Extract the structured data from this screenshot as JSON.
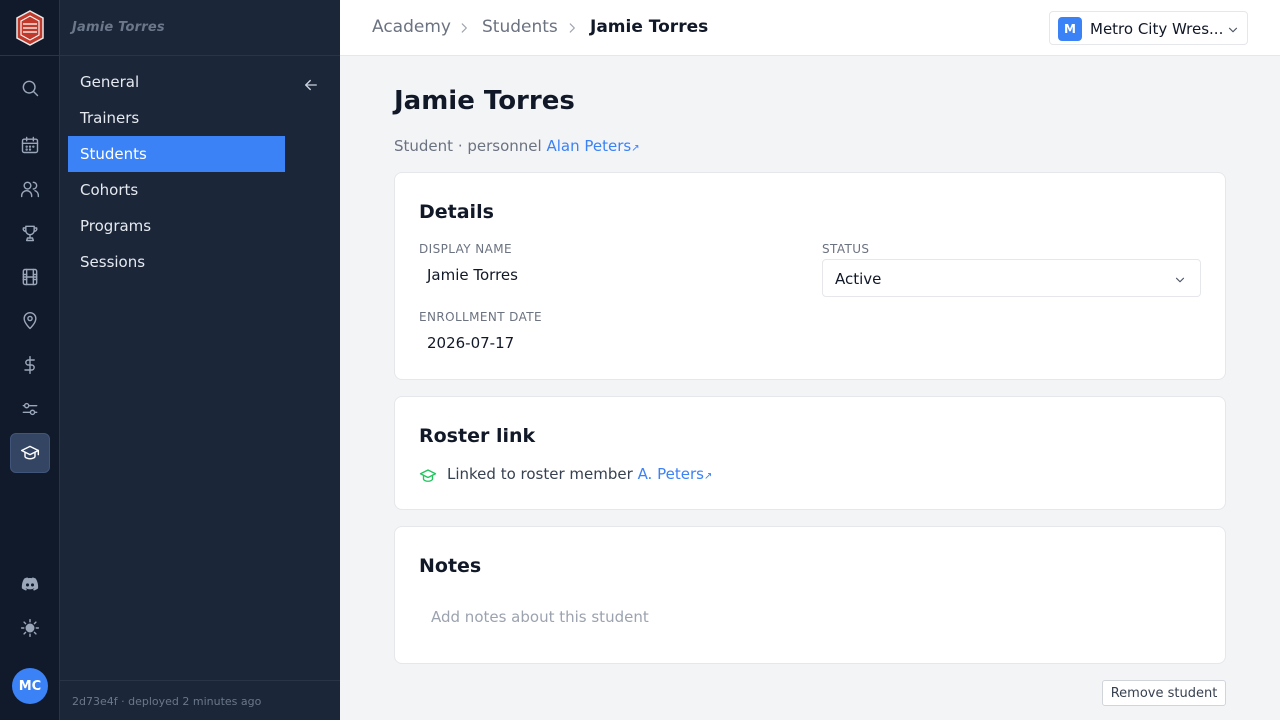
{
  "rail": {
    "items": [
      {
        "name": "search-icon",
        "active": false
      },
      {
        "name": "calendar-icon",
        "active": false
      },
      {
        "name": "users-icon",
        "active": false
      },
      {
        "name": "trophy-icon",
        "active": false
      },
      {
        "name": "film-icon",
        "active": false
      },
      {
        "name": "map-pin-icon",
        "active": false
      },
      {
        "name": "dollar-icon",
        "active": false
      },
      {
        "name": "sliders-icon",
        "active": false
      },
      {
        "name": "graduation-cap-icon",
        "active": true
      }
    ],
    "bottom": [
      {
        "name": "discord-icon"
      },
      {
        "name": "theme-sun-icon"
      }
    ],
    "avatar_initials": "MC"
  },
  "subnav": {
    "title": "Jamie Torres",
    "items": [
      {
        "label": "General",
        "active": false
      },
      {
        "label": "Trainers",
        "active": false
      },
      {
        "label": "Students",
        "active": true
      },
      {
        "label": "Cohorts",
        "active": false
      },
      {
        "label": "Programs",
        "active": false
      },
      {
        "label": "Sessions",
        "active": false
      }
    ],
    "footer": "2d73e4f · deployed 2 minutes ago"
  },
  "breadcrumb": {
    "items": [
      "Academy",
      "Students"
    ],
    "current": "Jamie Torres"
  },
  "org": {
    "badge": "M",
    "name": "Metro City Wres..."
  },
  "page": {
    "title": "Jamie Torres",
    "subtitle_prefix": "Student · personnel",
    "subtitle_link": "Alan Peters",
    "external_glyph": "↗"
  },
  "details": {
    "title": "Details",
    "display_name_label": "DISPLAY NAME",
    "display_name_value": "Jamie Torres",
    "status_label": "STATUS",
    "status_value": "Active",
    "enrollment_label": "ENROLLMENT DATE",
    "enrollment_value": "2026-07-17"
  },
  "roster": {
    "title": "Roster link",
    "text": "Linked to roster member",
    "link": "A. Peters",
    "external_glyph": "↗"
  },
  "notes": {
    "title": "Notes",
    "placeholder": "Add notes about this student",
    "value": ""
  },
  "actions": {
    "remove_label": "Remove student"
  },
  "colors": {
    "accent": "#3b82f6",
    "rail_bg": "#111a2b",
    "subnav_bg": "#1b2638",
    "roster_icon": "#22c55e"
  }
}
